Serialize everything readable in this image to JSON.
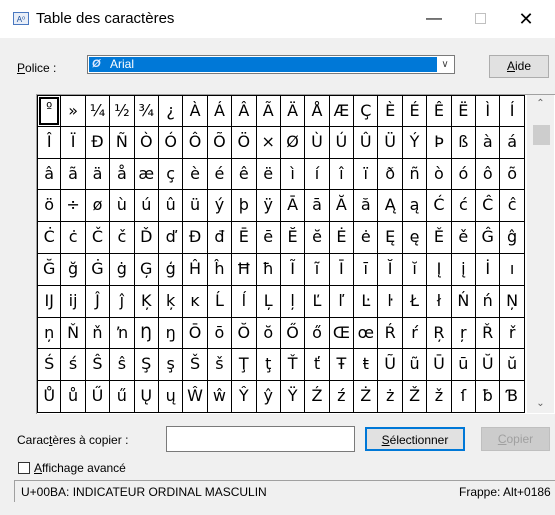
{
  "window": {
    "title": "Table des caractères",
    "app_icon": "character-map-icon",
    "minimize": "—",
    "close": "✕"
  },
  "font": {
    "label": "Police :",
    "selected": "Arial",
    "help_label": "Aide"
  },
  "characters": [
    "º",
    "»",
    "¼",
    "½",
    "¾",
    "¿",
    "À",
    "Á",
    "Â",
    "Ã",
    "Ä",
    "Å",
    "Æ",
    "Ç",
    "È",
    "É",
    "Ê",
    "Ë",
    "Ì",
    "Í",
    "Î",
    "Ï",
    "Ð",
    "Ñ",
    "Ò",
    "Ó",
    "Ô",
    "Õ",
    "Ö",
    "×",
    "Ø",
    "Ù",
    "Ú",
    "Û",
    "Ü",
    "Ý",
    "Þ",
    "ß",
    "à",
    "á",
    "â",
    "ã",
    "ä",
    "å",
    "æ",
    "ç",
    "è",
    "é",
    "ê",
    "ë",
    "ì",
    "í",
    "î",
    "ï",
    "ð",
    "ñ",
    "ò",
    "ó",
    "ô",
    "õ",
    "ö",
    "÷",
    "ø",
    "ù",
    "ú",
    "û",
    "ü",
    "ý",
    "þ",
    "ÿ",
    "Ā",
    "ā",
    "Ă",
    "ă",
    "Ą",
    "ą",
    "Ć",
    "ć",
    "Ĉ",
    "ĉ",
    "Ċ",
    "ċ",
    "Č",
    "č",
    "Ď",
    "ď",
    "Đ",
    "đ",
    "Ē",
    "ē",
    "Ĕ",
    "ĕ",
    "Ė",
    "ė",
    "Ę",
    "ę",
    "Ě",
    "ě",
    "Ĝ",
    "ĝ",
    "Ğ",
    "ğ",
    "Ġ",
    "ġ",
    "Ģ",
    "ģ",
    "Ĥ",
    "ĥ",
    "Ħ",
    "ħ",
    "Ĩ",
    "ĩ",
    "Ī",
    "ī",
    "Ĭ",
    "ĭ",
    "Į",
    "į",
    "İ",
    "ı",
    "Ĳ",
    "ĳ",
    "Ĵ",
    "ĵ",
    "Ķ",
    "ķ",
    "ĸ",
    "Ĺ",
    "ĺ",
    "Ļ",
    "ļ",
    "Ľ",
    "ľ",
    "Ŀ",
    "ŀ",
    "Ł",
    "ł",
    "Ń",
    "ń",
    "Ņ",
    "ņ",
    "Ň",
    "ň",
    "ŉ",
    "Ŋ",
    "ŋ",
    "Ō",
    "ō",
    "Ŏ",
    "ŏ",
    "Ő",
    "ő",
    "Œ",
    "œ",
    "Ŕ",
    "ŕ",
    "Ŗ",
    "ŗ",
    "Ř",
    "ř",
    "Ś",
    "ś",
    "Ŝ",
    "ŝ",
    "Ş",
    "ş",
    "Š",
    "š",
    "Ţ",
    "ţ",
    "Ť",
    "ť",
    "Ŧ",
    "ŧ",
    "Ũ",
    "ũ",
    "Ū",
    "ū",
    "Ŭ",
    "ŭ",
    "Ů",
    "ů",
    "Ű",
    "ű",
    "Ų",
    "ų",
    "Ŵ",
    "ŵ",
    "Ŷ",
    "ŷ",
    "Ÿ",
    "Ź",
    "ź",
    "Ż",
    "ż",
    "Ž",
    "ž",
    "ſ",
    "ƀ",
    "Ɓ"
  ],
  "selected_index": 0,
  "copy": {
    "label": "Caractères à copier :",
    "value": "",
    "select_button": "Sélectionner",
    "copy_button": "Copier"
  },
  "advanced": {
    "label": "Affichage avancé",
    "checked": false
  },
  "status": {
    "left": "U+00BA: INDICATEUR ORDINAL MASCULIN",
    "right": "Frappe: Alt+0186"
  },
  "colors": {
    "selection": "#0078d7"
  }
}
